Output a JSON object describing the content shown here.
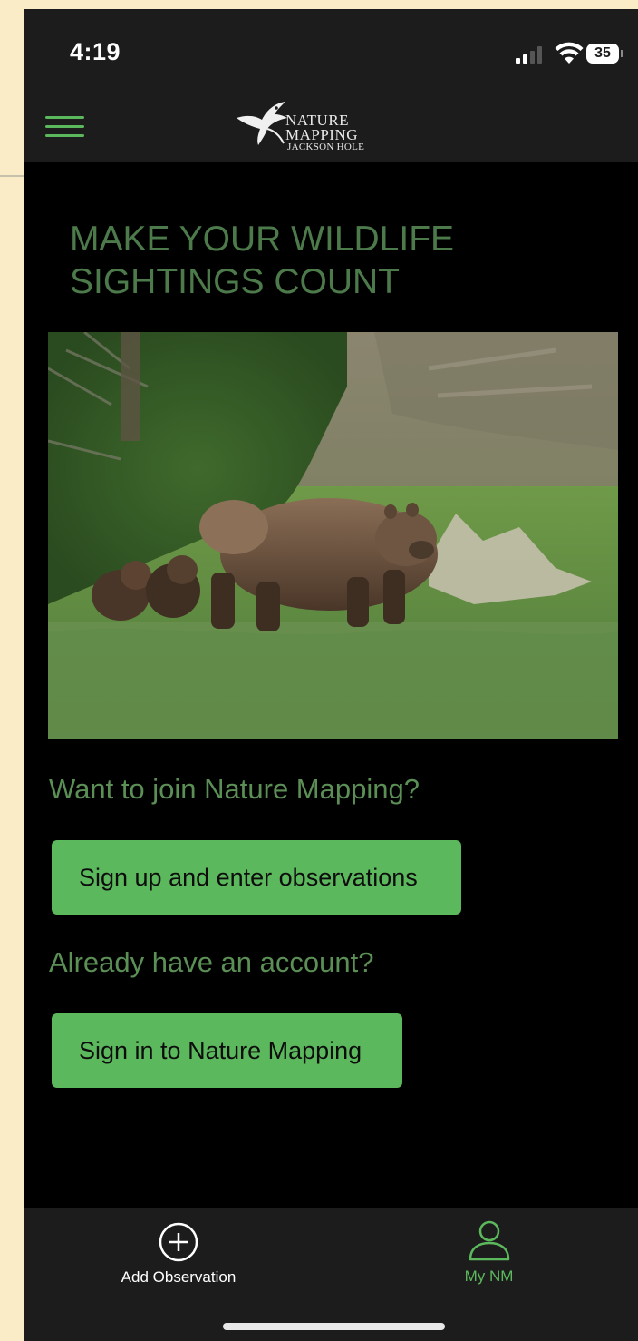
{
  "status_bar": {
    "time": "4:19",
    "battery": "35"
  },
  "header": {
    "logo_line1": "NATURE",
    "logo_line2": "MAPPING",
    "logo_line3": "JACKSON HOLE"
  },
  "main": {
    "headline": "MAKE YOUR WILDLIFE SIGHTINGS COUNT",
    "join_question": "Want to join Nature Mapping?",
    "signup_label": "Sign up and enter observations",
    "account_question": "Already have an account?",
    "signin_label": "Sign in to Nature Mapping"
  },
  "tabbar": {
    "tabs": [
      {
        "label": "Add Observation",
        "icon": "plus-circle-icon",
        "color": "#ffffff"
      },
      {
        "label": "My NM",
        "icon": "person-icon",
        "color": "#5cb85c"
      }
    ]
  },
  "colors": {
    "accent": "#5cb85c",
    "headline": "#4d7a4a",
    "header_bg": "#1c1c1c"
  }
}
